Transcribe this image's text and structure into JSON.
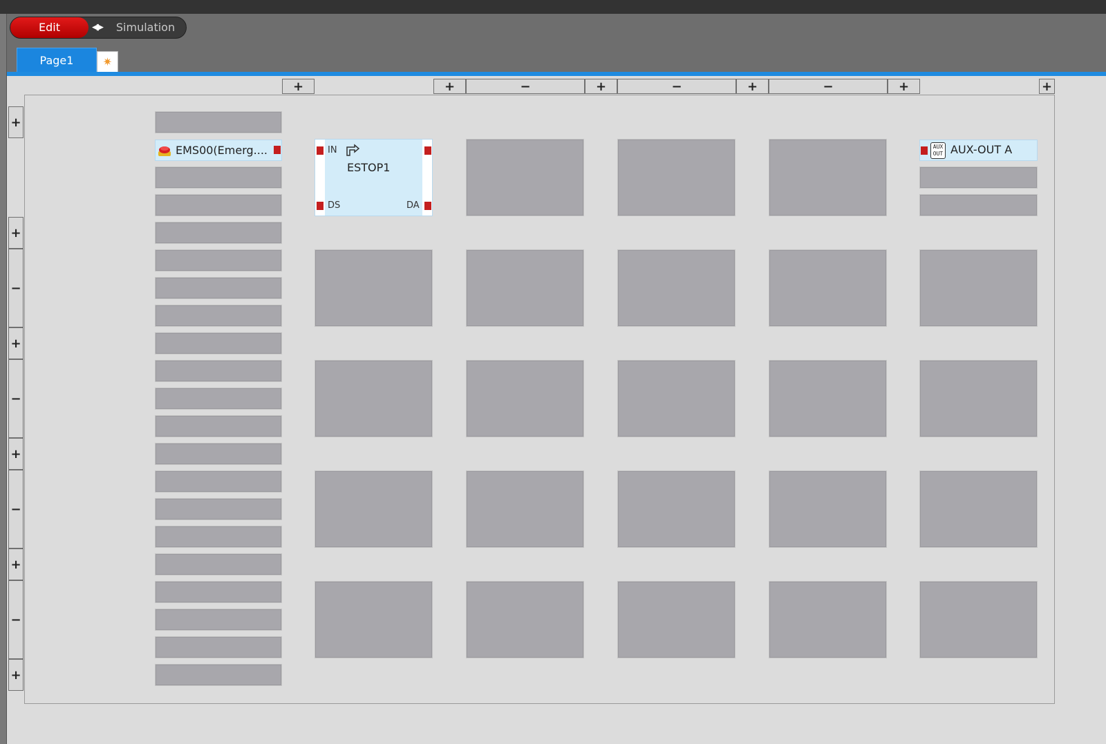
{
  "mode": {
    "edit_label": "Edit",
    "simulation_label": "Simulation",
    "switch_glyph": "◀▶"
  },
  "tabs": {
    "page_label": "Page1",
    "new_tab_icon": "new-page-icon",
    "new_tab_glyph": "✷"
  },
  "controls": {
    "add": "+",
    "remove": "−"
  },
  "inputs": {
    "items": [
      "EMS00(Emerg...."
    ]
  },
  "logic_block": {
    "title": "ESTOP1",
    "ports": {
      "in": "IN",
      "ds": "DS",
      "da": "DA"
    },
    "icon": "logic-reset-icon"
  },
  "outputs": {
    "items": [
      "AUX-OUT A"
    ],
    "icon_text_top": "AUX",
    "icon_text_bottom": "OUT"
  },
  "colors": {
    "edit": "#d10a0a",
    "accent": "#1b86df",
    "terminal": "#c41f1f",
    "selected_block": "#d3ecf9"
  }
}
